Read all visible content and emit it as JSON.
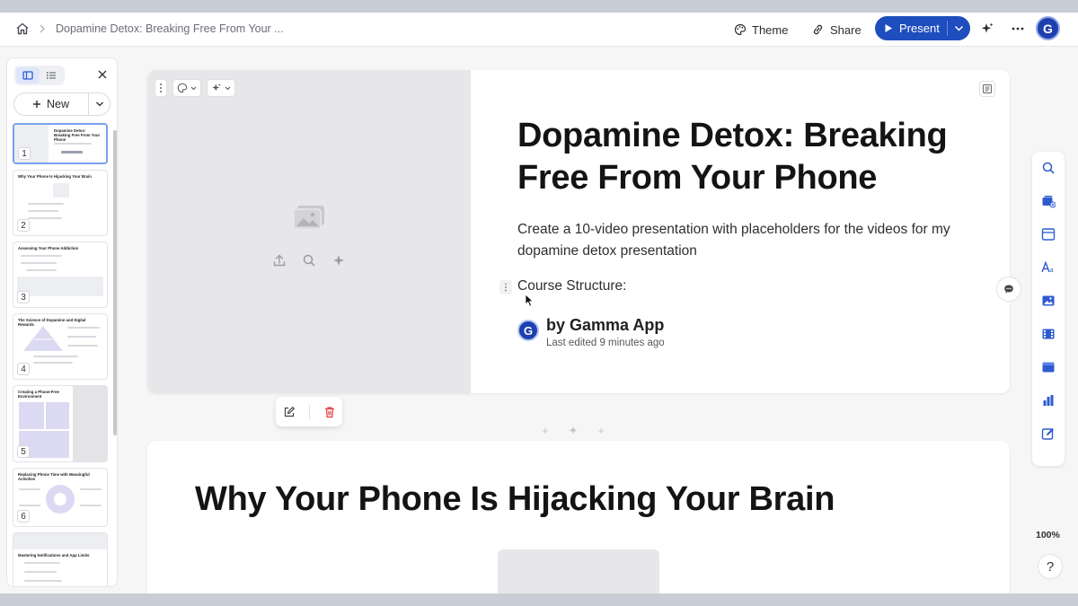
{
  "topbar": {
    "breadcrumb_title": "Dopamine Detox: Breaking Free From Your ...",
    "theme_label": "Theme",
    "share_label": "Share",
    "present_label": "Present",
    "user_initial": "G"
  },
  "sidebar": {
    "new_label": "New",
    "thumbnails": [
      {
        "number": "1",
        "title": "Dopamine Detox: Breaking Free From Your Phone"
      },
      {
        "number": "2",
        "title": "Why Your Phone Is Hijacking Your Brain"
      },
      {
        "number": "3",
        "title": "Assessing Your Phone Addiction"
      },
      {
        "number": "4",
        "title": "The Science of Dopamine and Digital Rewards"
      },
      {
        "number": "5",
        "title": "Creating a Phone-Free Environment"
      },
      {
        "number": "6",
        "title": "Replacing Phone Time with Meaningful Activities"
      },
      {
        "number": "7",
        "title": "Mastering Notifications and App Limits"
      }
    ]
  },
  "card1": {
    "title": "Dopamine Detox: Breaking Free From Your Phone",
    "description": "Create a 10-video presentation with placeholders for the videos for my dopamine detox presentation",
    "course_structure": "Course Structure:",
    "author_initial": "G",
    "author_name": "by Gamma App",
    "last_edited": "Last edited 9 minutes ago"
  },
  "card2": {
    "title": "Why Your Phone Is Hijacking Your Brain"
  },
  "zoom": "100%",
  "help_label": "?",
  "colors": {
    "accent": "#1e4dbd",
    "avatar": "#1e40af"
  }
}
